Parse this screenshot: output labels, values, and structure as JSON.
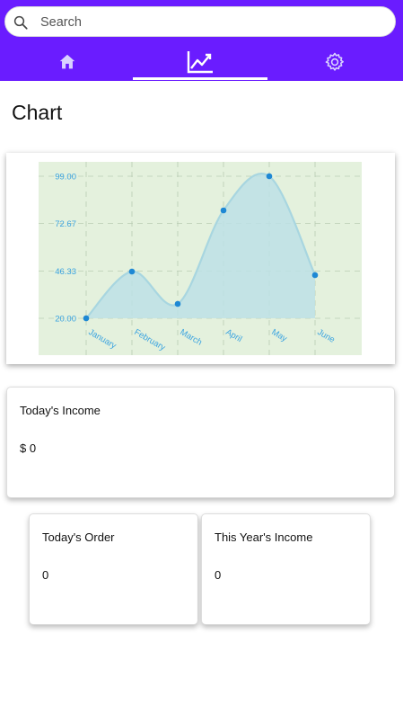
{
  "search": {
    "placeholder": "Search",
    "icon": "search-icon"
  },
  "tabs": [
    {
      "icon": "home-icon",
      "active": false
    },
    {
      "icon": "chart-line-icon",
      "active": true
    },
    {
      "icon": "gear-icon",
      "active": false
    }
  ],
  "colors": {
    "primary": "#6a1cff",
    "chart_bg": "#e4f1dd",
    "chart_fill": "#bde0e6",
    "chart_line": "#a8d6e0",
    "point": "#1e88d4",
    "axis_text": "#3aa3e0"
  },
  "page": {
    "title": "Chart"
  },
  "chart_data": {
    "type": "area",
    "categories": [
      "January",
      "February",
      "March",
      "April",
      "May",
      "June"
    ],
    "values": [
      20,
      46,
      28,
      80,
      99,
      44
    ],
    "y_ticks": [
      "20.00",
      "46.33",
      "72.67",
      "99.00"
    ],
    "ylim": [
      20,
      99
    ],
    "grid": true
  },
  "cards": {
    "income": {
      "label": "Today's Income",
      "value": "$ 0"
    },
    "order": {
      "label": "Today's Order",
      "value": "0"
    },
    "year": {
      "label": "This Year's Income",
      "value": "0"
    }
  }
}
